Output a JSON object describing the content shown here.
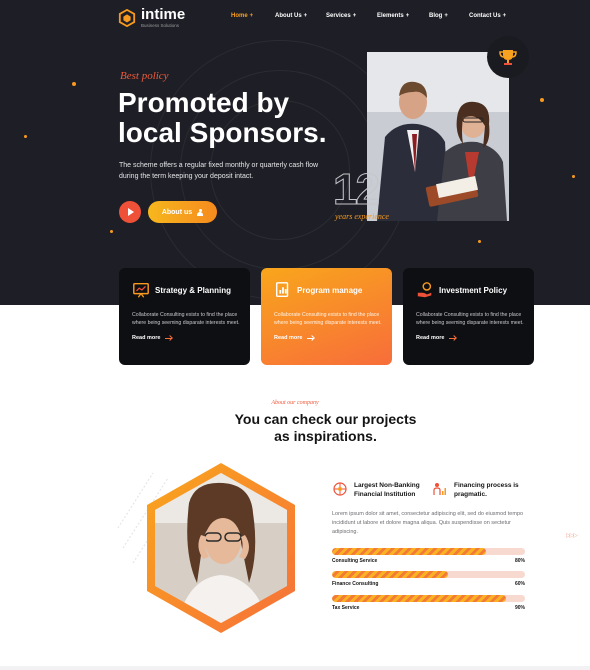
{
  "brand": {
    "name": "intime",
    "tagline": "Business Solutions",
    "accent": "#f79a1e",
    "accent_red": "#ef5138",
    "dark": "#1e1f26"
  },
  "nav": [
    {
      "label": "Home",
      "plus": "+",
      "active": true
    },
    {
      "label": "About Us",
      "plus": "+",
      "active": false
    },
    {
      "label": "Services",
      "plus": "+",
      "active": false
    },
    {
      "label": "Elements",
      "plus": "+",
      "active": false
    },
    {
      "label": "Blog",
      "plus": "+",
      "active": false
    },
    {
      "label": "Contact Us",
      "plus": "+",
      "active": false
    }
  ],
  "hero": {
    "eyebrow": "Best policy",
    "title_line1": "Promoted by",
    "title_line2": "local Sponsors.",
    "description": "The scheme offers a regular fixed monthly or quarterly cash flow during the term keeping your deposit intact.",
    "about_button": "About us",
    "years_number": "12",
    "years_label": "years experience",
    "trophy_icon": "trophy-icon",
    "play_icon": "play-icon"
  },
  "cards": [
    {
      "title": "Strategy & Planning",
      "icon": "presentation-icon",
      "text": "Collaborate Consulting exists to find the place where being seeming disparate interests meet.",
      "link": "Read more",
      "featured": false
    },
    {
      "title": "Program manage",
      "icon": "document-chart-icon",
      "text": "Collaborate Consulting exists to find the place where being seeming disparate interests meet.",
      "link": "Read more",
      "featured": true
    },
    {
      "title": "Investment Policy",
      "icon": "hand-money-icon",
      "text": "Collaborate Consulting exists to find the place where being seeming disparate interests meet.",
      "link": "Read more",
      "featured": false
    }
  ],
  "about": {
    "eyebrow": "About our company",
    "title_line1": "You can check our projects",
    "title_line2": "as inspirations.",
    "features": [
      {
        "label_line1": "Largest Non-Banking",
        "label_line2": "Financial Institution",
        "icon": "network-icon"
      },
      {
        "label_line1": "Financing process is",
        "label_line2": "pragmatic.",
        "icon": "growth-person-icon"
      }
    ],
    "paragraph": "Lorem ipsum dolor sit amet, consectetur adipiscing elit, sed do eiusmod tempo incididunt ut labore et dolore magna aliqua. Quis suspendisse on sectetur adipiscing.",
    "progress": [
      {
        "label": "Consulting Service",
        "value_text": "80%",
        "value": 80
      },
      {
        "label": "Finance Consulting",
        "value_text": "60%",
        "value": 60
      },
      {
        "label": "Tax Service",
        "value_text": "90%",
        "value": 90
      }
    ]
  }
}
